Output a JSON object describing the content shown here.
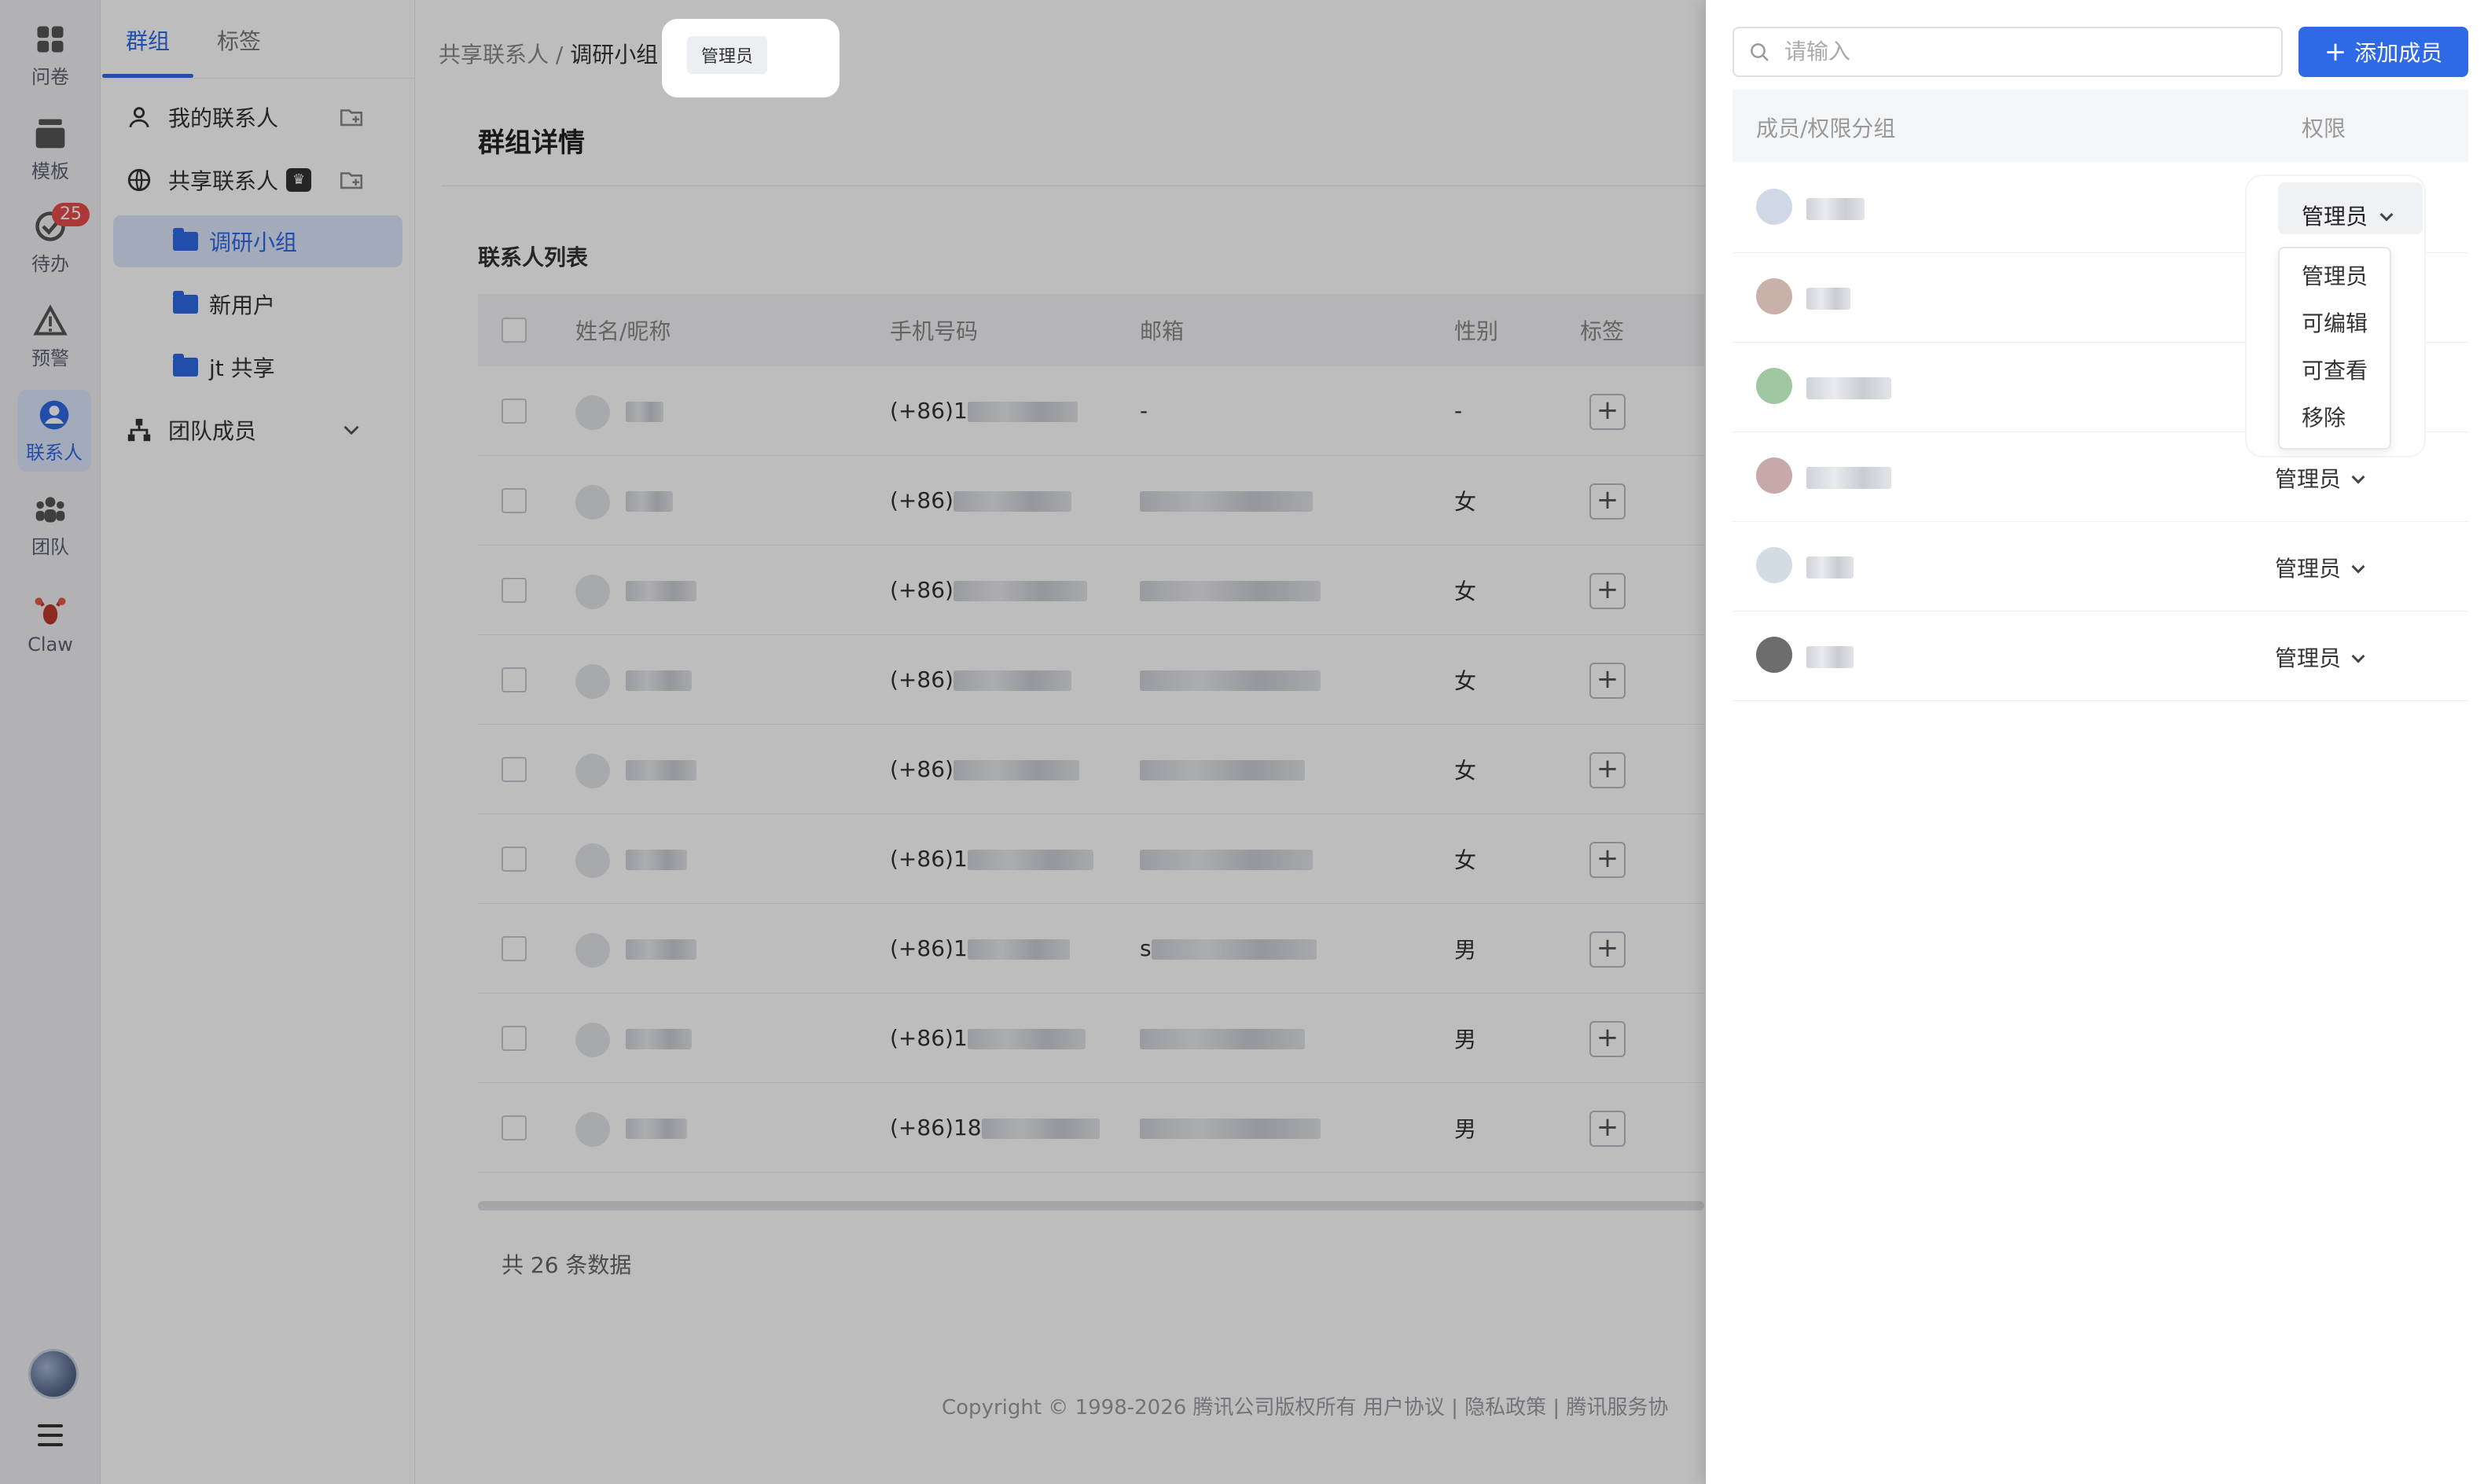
{
  "rail": {
    "items": [
      {
        "label": "问卷",
        "icon": "grid-icon"
      },
      {
        "label": "模板",
        "icon": "stack-icon"
      },
      {
        "label": "待办",
        "icon": "check-circle-icon",
        "badge": "25"
      },
      {
        "label": "预警",
        "icon": "warning-icon"
      },
      {
        "label": "联系人",
        "icon": "contact-icon",
        "active": true
      },
      {
        "label": "团队",
        "icon": "team-icon"
      },
      {
        "label": "Claw",
        "icon": "lobster-icon"
      }
    ]
  },
  "sidebar": {
    "tabs": [
      "群组",
      "标签"
    ],
    "items": [
      {
        "label": "我的联系人"
      },
      {
        "label": "共享联系人"
      },
      {
        "label": "调研小组"
      },
      {
        "label": "新用户"
      },
      {
        "label": "jt 共享"
      },
      {
        "label": "团队成员"
      }
    ]
  },
  "breadcrumb": {
    "root": "共享联系人 /",
    "current": "调研小组",
    "tag": "管理员"
  },
  "main": {
    "title": "群组详情",
    "list_title": "联系人列表",
    "columns": [
      "姓名/昵称",
      "手机号码",
      "邮箱",
      "性别",
      "标签"
    ],
    "rows": [
      {
        "phone": "(+86)1",
        "email": "-",
        "gender": "-"
      },
      {
        "phone": "(+86)",
        "email": "",
        "gender": "女"
      },
      {
        "phone": "(+86)",
        "email": "",
        "gender": "女"
      },
      {
        "phone": "(+86)",
        "email": "",
        "gender": "女"
      },
      {
        "phone": "(+86)",
        "email": "",
        "gender": "女"
      },
      {
        "phone": "(+86)1",
        "email": "",
        "gender": "女"
      },
      {
        "phone": "(+86)1",
        "email": "s",
        "gender": "男"
      },
      {
        "phone": "(+86)1",
        "email": "",
        "gender": "男"
      },
      {
        "phone": "(+86)18",
        "email": "",
        "gender": "男"
      }
    ],
    "total": "共 26 条数据",
    "footer": "Copyright © 1998-2026 腾讯公司版权所有 用户协议 | 隐私政策 | 腾讯服务协"
  },
  "panel": {
    "search_placeholder": "请输入",
    "add_button": "添加成员",
    "col_member": "成员/权限分组",
    "col_perm": "权限",
    "rows": [
      {
        "perm": "管理员"
      },
      {
        "perm": ""
      },
      {
        "perm": ""
      },
      {
        "perm": "管理员"
      },
      {
        "perm": "管理员"
      },
      {
        "perm": "管理员"
      }
    ],
    "dropdown": [
      "管理员",
      "可编辑",
      "可查看",
      "移除"
    ],
    "selected": "管理员"
  }
}
